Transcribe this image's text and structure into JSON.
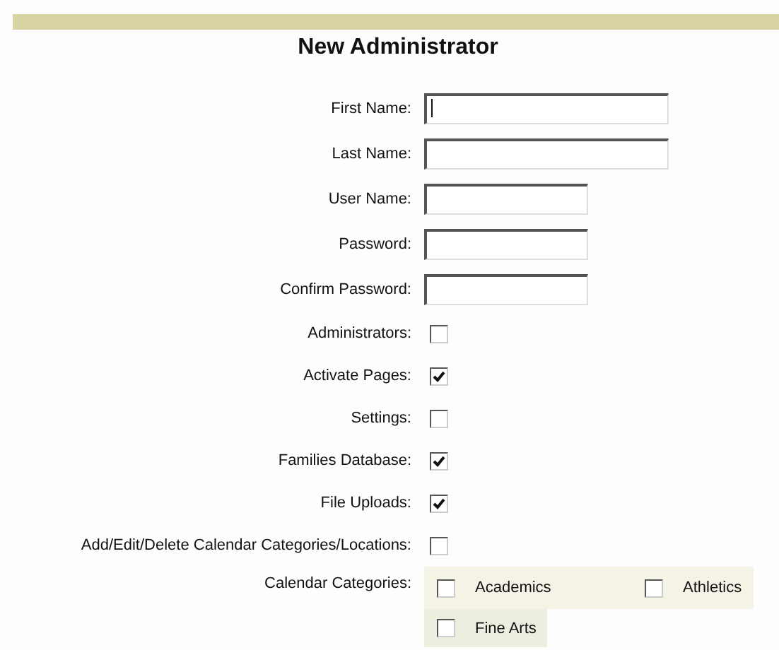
{
  "title": "New Administrator",
  "text_fields": [
    {
      "label": "First Name:",
      "kind": "wide",
      "focused": true
    },
    {
      "label": "Last Name:",
      "kind": "wide",
      "focused": false
    },
    {
      "label": "User Name:",
      "kind": "narrow",
      "focused": false
    },
    {
      "label": "Password:",
      "kind": "narrow",
      "focused": false
    },
    {
      "label": "Confirm Password:",
      "kind": "narrow",
      "focused": false
    }
  ],
  "permissions": [
    {
      "label": "Administrators:",
      "checked": false
    },
    {
      "label": "Activate Pages:",
      "checked": true
    },
    {
      "label": "Settings:",
      "checked": false
    },
    {
      "label": "Families Database:",
      "checked": true
    },
    {
      "label": "File Uploads:",
      "checked": true
    },
    {
      "label": "Add/Edit/Delete Calendar Categories/Locations:",
      "checked": false
    }
  ],
  "calendar_categories": {
    "label": "Calendar Categories:",
    "rows": [
      [
        {
          "label": "Academics",
          "checked": false
        },
        {
          "label": "Athletics",
          "checked": false
        }
      ],
      [
        {
          "label": "Fine Arts",
          "checked": false
        }
      ]
    ]
  }
}
